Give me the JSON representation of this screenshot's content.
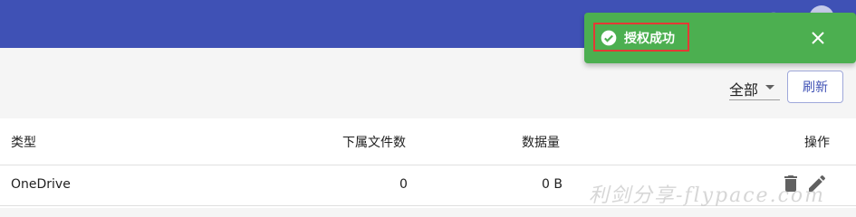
{
  "header": {
    "brand_color": "#3f51b5"
  },
  "toolbar": {
    "filter": {
      "selected": "全部",
      "icon": "chevron-down-icon"
    },
    "refresh_label": "刷新"
  },
  "table": {
    "columns": [
      "类型",
      "下属文件数",
      "数据量",
      "操作"
    ],
    "rows": [
      {
        "type": "OneDrive",
        "file_count": "0",
        "data_size": "0 B",
        "actions": [
          "delete-icon",
          "edit-icon"
        ]
      }
    ]
  },
  "snackbar": {
    "message": "授权成功",
    "icon": "check-circle-icon",
    "close_icon": "close-icon",
    "color": "#4caf50"
  },
  "watermark": {
    "text": "利剑分享-flypace.com"
  }
}
